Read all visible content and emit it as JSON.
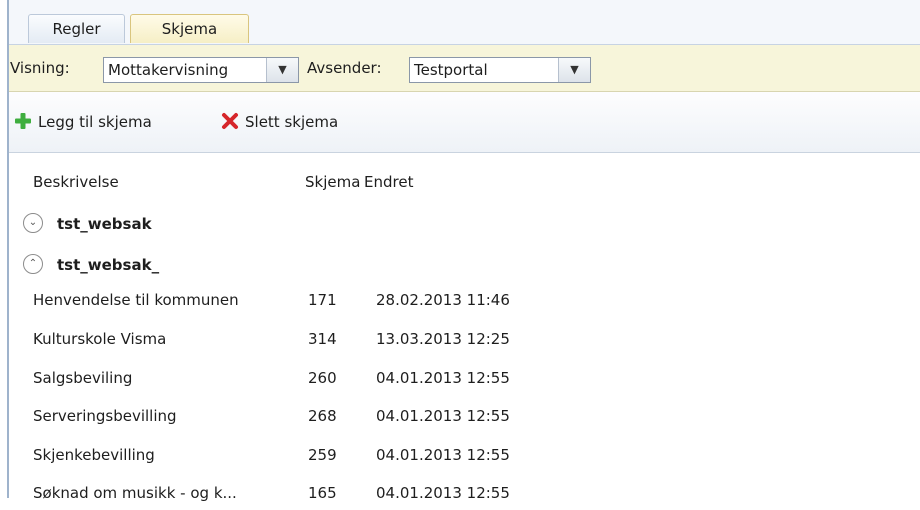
{
  "tabs": [
    {
      "label": "Regler",
      "active": false
    },
    {
      "label": "Skjema",
      "active": true
    }
  ],
  "filters": {
    "visning_label": "Visning:",
    "visning_value": "Mottakervisning",
    "avsender_label": "Avsender:",
    "avsender_value": "Testportal"
  },
  "toolbar": {
    "add_label": "Legg til skjema",
    "delete_label": "Slett skjema",
    "add_icon": "green-plus-icon",
    "delete_icon": "red-x-icon"
  },
  "table": {
    "columns": [
      "Beskrivelse",
      "Skjema",
      "Endret"
    ],
    "groups": [
      {
        "name": "tst_websak",
        "expanded": false,
        "rows": []
      },
      {
        "name": "tst_websak_",
        "expanded": true,
        "rows": [
          {
            "beskrivelse": "Henvendelse til kommunen",
            "skjema": "171",
            "endret": "28.02.2013 11:46"
          },
          {
            "beskrivelse": "Kulturskole Visma",
            "skjema": "314",
            "endret": "13.03.2013 12:25"
          },
          {
            "beskrivelse": "Salgsbeviling",
            "skjema": "260",
            "endret": "04.01.2013 12:55"
          },
          {
            "beskrivelse": "Serveringsbevilling",
            "skjema": "268",
            "endret": "04.01.2013 12:55"
          },
          {
            "beskrivelse": "Skjenkebevilling",
            "skjema": "259",
            "endret": "04.01.2013 12:55"
          },
          {
            "beskrivelse": "Søknad om musikk - og k...",
            "skjema": "165",
            "endret": "04.01.2013 12:55"
          }
        ]
      }
    ]
  },
  "colors": {
    "filter_bar_bg": "#f7f5da",
    "active_tab_bg": "#f6efc6",
    "add_icon_color": "#3fae3f",
    "delete_icon_color": "#d6262b"
  }
}
